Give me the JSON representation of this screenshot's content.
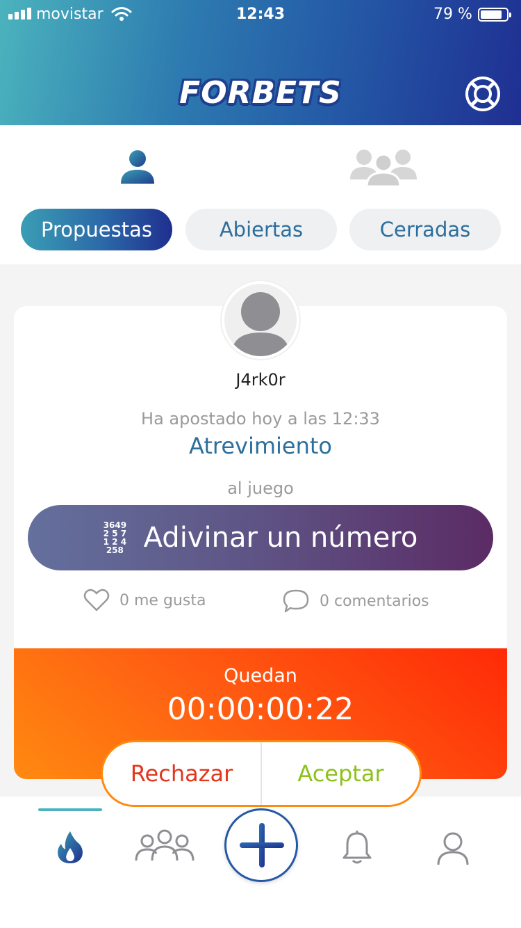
{
  "status_bar": {
    "carrier": "movistar",
    "time": "12:43",
    "battery": "79 %"
  },
  "header": {
    "logo_text": "FORBETS",
    "help_icon": "lifebuoy-icon"
  },
  "segment": {
    "icons": [
      "single-user-icon",
      "group-icon"
    ],
    "tabs": [
      {
        "label": "Propuestas",
        "active": true
      },
      {
        "label": "Abiertas",
        "active": false
      },
      {
        "label": "Cerradas",
        "active": false
      }
    ]
  },
  "bet": {
    "username": "J4rk0r",
    "timestamp": "Ha apostado hoy a las 12:33",
    "bet_name": "Atrevimiento",
    "game_intro": "al juego",
    "game_name": "Adivinar un número",
    "game_icon": "numbers-icon",
    "likes": "0 me gusta",
    "comments": "0 comentarios"
  },
  "countdown": {
    "label": "Quedan",
    "time": "00:00:00:22"
  },
  "actions": {
    "reject": "Rechazar",
    "accept": "Aceptar"
  },
  "tabbar": {
    "items": [
      "flame-icon",
      "groups-icon",
      "plus-icon",
      "bell-icon",
      "profile-icon"
    ],
    "active": "flame-icon"
  },
  "colors": {
    "accent_blue": "#2c6e9c",
    "header_gradient": [
      "#4bb3bd",
      "#1f2f92"
    ],
    "countdown_gradient": [
      "#ff8a10",
      "#ff2a06"
    ],
    "reject": "#e2361d",
    "accept": "#8cc21a",
    "game_gradient": [
      "#64709d",
      "#5b2b65"
    ]
  }
}
